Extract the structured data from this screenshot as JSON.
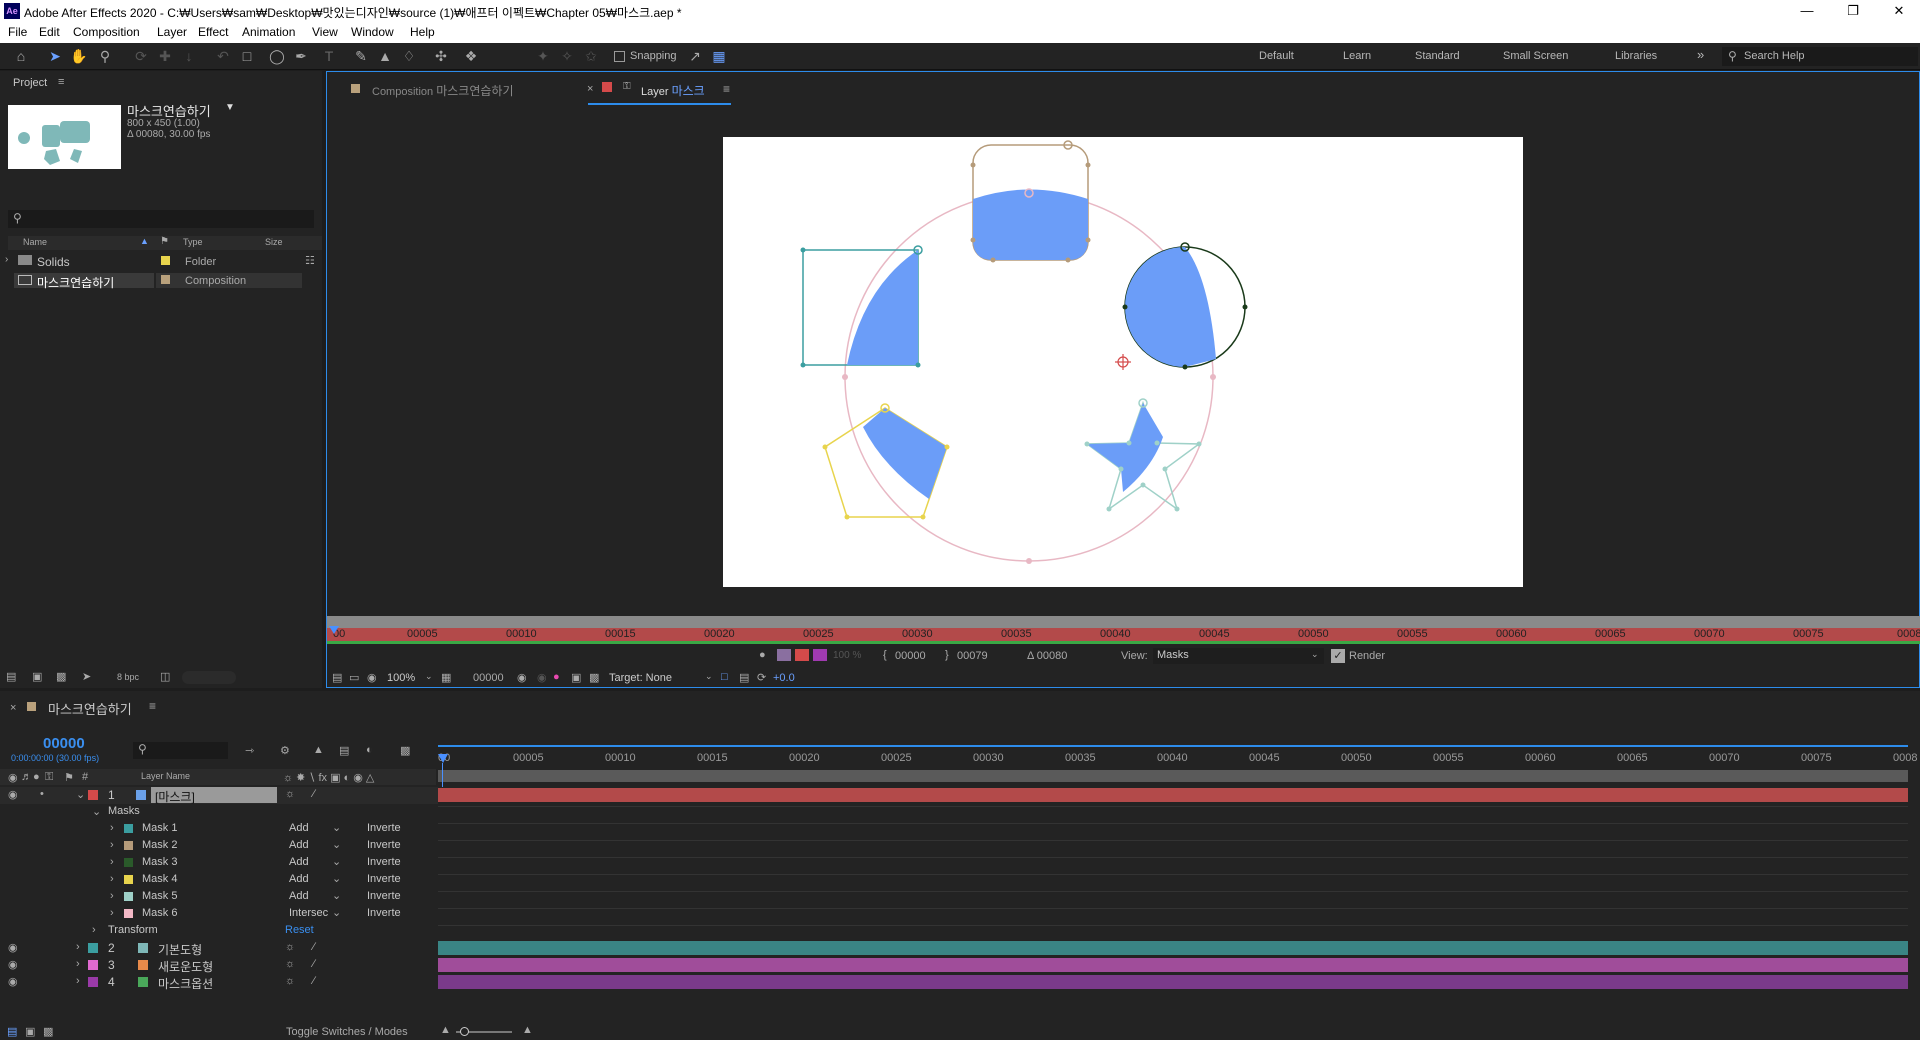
{
  "app": {
    "logo": "Ae",
    "title": "Adobe After Effects 2020 - C:₩Users₩sam₩Desktop₩맛있는디자인₩source (1)₩애프터 이펙트₩Chapter 05₩마스크.aep *"
  },
  "menu": [
    "File",
    "Edit",
    "Composition",
    "Layer",
    "Effect",
    "Animation",
    "View",
    "Window",
    "Help"
  ],
  "toolbar": {
    "snapping_label": "Snapping",
    "workspaces": [
      "Default",
      "Learn",
      "Standard",
      "Small Screen",
      "Libraries"
    ],
    "search_placeholder": "Search Help"
  },
  "project": {
    "panel_title": "Project",
    "comp_name": "마스크연습하기",
    "comp_size": "800 x 450 (1.00)",
    "comp_duration": "Δ 00080, 30.00 fps",
    "columns": {
      "name": "Name",
      "type": "Type",
      "size": "Size"
    },
    "items": [
      {
        "name": "Solids",
        "type": "Folder",
        "color": "#e8d44d"
      },
      {
        "name": "마스크연습하기",
        "type": "Composition",
        "color": "#b9a17c"
      }
    ],
    "bpc": "8 bpc"
  },
  "viewer": {
    "comp_tab_prefix": "Composition",
    "comp_tab_name": "마스크연습하기",
    "layer_tab_prefix": "Layer",
    "layer_tab_name": "마스크",
    "ruler_ticks": [
      "00",
      "00005",
      "00010",
      "00015",
      "00020",
      "00025",
      "00030",
      "00035",
      "00040",
      "00045",
      "00050",
      "00055",
      "00060",
      "00065",
      "00070",
      "00075",
      "0008"
    ],
    "in_point": "00000",
    "out_point": "00079",
    "duration": "Δ 00080",
    "view_label": "View:",
    "view_value": "Masks",
    "render_label": "Render",
    "zoom": "100%",
    "timecode": "00000",
    "target": "Target: None",
    "exposure": "+0.0",
    "opacity": "100 %"
  },
  "timeline": {
    "tab_title": "마스크연습하기",
    "timecode": "00000",
    "timecode_sub": "0:00:00:00 (30.00 fps)",
    "col_layer_name": "Layer Name",
    "ticks": [
      "00",
      "00005",
      "00010",
      "00015",
      "00020",
      "00025",
      "00030",
      "00035",
      "00040",
      "00045",
      "00050",
      "00055",
      "00060",
      "00065",
      "00070",
      "00075",
      "0008"
    ],
    "layers": [
      {
        "num": "1",
        "name": "[마스크]",
        "color": "#d44a4a",
        "label_color": "#6aa0e8",
        "bar": "#b34a4a"
      },
      {
        "num": "2",
        "name": "기본도형",
        "color": "#3b9ea0",
        "label_color": "#7fb8b8",
        "bar": "#3a8585"
      },
      {
        "num": "3",
        "name": "새로운도형",
        "color": "#e06ad0",
        "label_color": "#e88a4a",
        "bar": "#a04d9a"
      },
      {
        "num": "4",
        "name": "마스크옵션",
        "color": "#9a3aa8",
        "label_color": "#4aa85a",
        "bar": "#7a3a8a"
      }
    ],
    "masks_label": "Masks",
    "masks": [
      {
        "name": "Mask 1",
        "mode": "Add",
        "color": "#3b9ea0"
      },
      {
        "name": "Mask 2",
        "mode": "Add",
        "color": "#b59b7a"
      },
      {
        "name": "Mask 3",
        "mode": "Add",
        "color": "#2a5a2a"
      },
      {
        "name": "Mask 4",
        "mode": "Add",
        "color": "#e8d44d"
      },
      {
        "name": "Mask 5",
        "mode": "Add",
        "color": "#9fd1c8"
      },
      {
        "name": "Mask 6",
        "mode": "Intersec",
        "color": "#f2b8c6"
      }
    ],
    "inverted_label": "Inverte",
    "transform_label": "Transform",
    "reset_label": "Reset",
    "toggle_label": "Toggle Switches / Modes"
  }
}
